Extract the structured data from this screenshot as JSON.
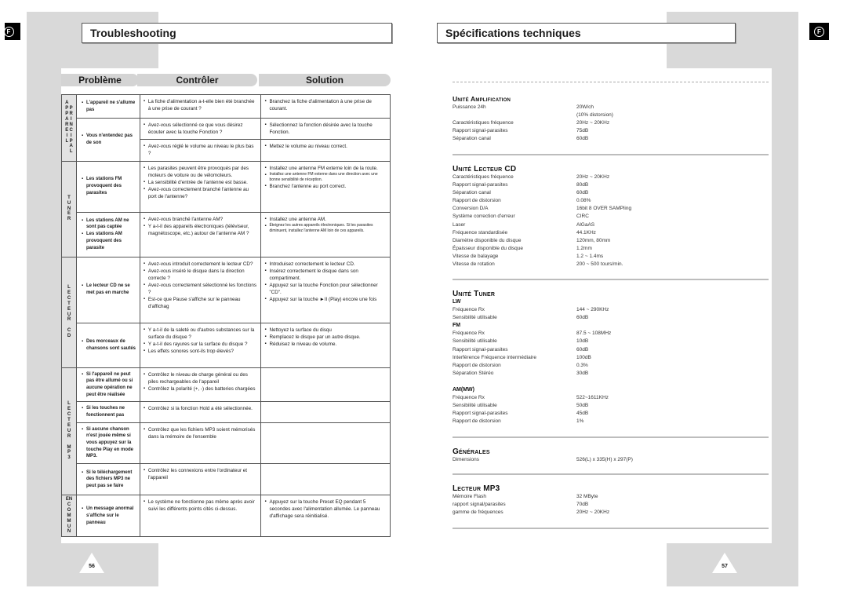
{
  "left_page": {
    "language_badge": "F",
    "title": "Troubleshooting",
    "headers": {
      "problem": "Problème",
      "check": "Contrôler",
      "solution": "Solution"
    },
    "groups": [
      {
        "category": "A\nP\nP\nA\nR\nE\nI\nL",
        "category2": "\nP\nR\nI\nN\nC\nI\nP\nA\nL",
        "rows": [
          {
            "problem": "L'appareil ne s'allume pas",
            "checks": [
              "La fiche d'alimentation a-t-elle bien été branchée à une prise de courant ?"
            ],
            "solutions": [
              "Branchez la fiche d'alimentation à une prise de courant."
            ]
          },
          {
            "problem": "Vous n'entendez pas de son",
            "checks": [
              "Avez-vous sélectionné ce que vous désirez écouter avec la touche Fonction ?"
            ],
            "solutions": [
              "Sélectionnez la fonction désirée avec la touche Fonction."
            ]
          },
          {
            "problem": "",
            "checks": [
              "Avez-vous réglé le volume au niveau le plus bas ?"
            ],
            "solutions": [
              "Mettez le volume au niveau correct."
            ]
          }
        ]
      },
      {
        "category": "T\nU\nN\nE\nR",
        "rows": [
          {
            "problem": "Les stations FM provoquent des parasites",
            "checks": [
              "Les parasites peuvent être provoqués par des moteurs de voiture ou de vélomoteurs.",
              "La sensibilité d'entrée de l'antenne est basse.",
              "Avez-vous correctement branché l'antenne au port de l'antenne?"
            ],
            "solutions": [
              "Installez une antenne FM externe loin de la route.",
              "Installez une antenne FM externe dans une direction avec une bonne sensibilité de réception.",
              "Branchez l'antenne au port correct."
            ]
          },
          {
            "problem": "Les stations AM ne sont pas captée",
            "problem2": "Les stations AM provoquent des parasite",
            "checks": [
              "Avez-vous branché l'antenne AM?",
              "Y a-t-il des appareils électroniques (téléviseur, magnétoscope, etc.) autour de l'antenne AM ?"
            ],
            "solutions": [
              "Installez une antenne AM.",
              "Éteignez les autres appareils électroniques. Si les parasites diminuent, installez l'antenne AM loin de ces appareils."
            ]
          }
        ]
      },
      {
        "category": "L\nE\nC\nT\nE\nU\nR\n\nC\nD",
        "rows": [
          {
            "problem": "Le lecteur CD ne se met pas en marche",
            "checks": [
              "Avez-vous introduit correctement le lecteur CD?",
              "Avez-vous inséré le disque dans la direction correcte ?",
              "Avez-vous correctement sélectionné les fonctions ?",
              "Est-ce que Pause s'affiche sur le panneau d'affichag"
            ],
            "solutions": [
              "Introduisez correctement le lecteur CD.",
              "Insérez correctement le disque dans son compartiment.",
              "Appuyez sur la touche Fonction pour sélectionner \"CD\".",
              "Appuyez sur la touche ►II (Play) encore une fois"
            ]
          },
          {
            "problem": "Des morceaux de chansons sont sautés",
            "checks": [
              "Y a-t-il de la saleté ou d'autres substances sur la surface du disque ?",
              "Y a-t-il des rayures sur la surface du disque ?",
              "Les effets sonores sont-ils trop élevés?"
            ],
            "solutions": [
              "Nettoyez la surface du disqu",
              "Remplacez le disque par un autre disque.",
              "Réduisez le niveau de volume."
            ]
          }
        ]
      },
      {
        "category": "L\nE\nC\nT\nE\nU\nR\n\nM\nP\n3",
        "rows": [
          {
            "problem": "Si l'appareil ne peut pas être allumé ou si aucune opération ne peut être réalisée",
            "checks": [
              "Contrôlez le niveau de charge général ou des piles rechargeables de l'appareil",
              "Contrôlez la polarité (+, -) des batteries chargées"
            ],
            "solutions": []
          },
          {
            "problem": "Si les touches ne fonctionnent pas",
            "checks": [
              "Contrôlez si la fonction Hold a été sélectionnée."
            ],
            "solutions": []
          },
          {
            "problem": "Si aucune chanson n'est jouée même si vous appuyez sur la touche Play en mode MP3.",
            "checks": [
              "Contrôlez que les fichiers MP3 soient mémorisés dans la mémoire de l'ensemble"
            ],
            "solutions": []
          },
          {
            "problem": "Si le téléchargement des fichiers MP3 ne peut pas se faire",
            "checks": [
              "Contrôlez les connexions entre l'ordinateur et l'appareil"
            ],
            "solutions": []
          }
        ]
      },
      {
        "category": "EN\nC\nO\nM\nM\nU\nN",
        "rows": [
          {
            "problem": "Un message anormal s'affiche sur le panneau",
            "checks": [
              "Le système ne fonctionne pas même après avoir suivi les différents points cités ci-dessus."
            ],
            "solutions": [
              "Appuyez sur la touche Preset EQ pendant 5 secondes avec l'alimentation allumée. Le panneau d'affichage sera réinitialisé."
            ]
          }
        ]
      }
    ],
    "page_number": "56"
  },
  "right_page": {
    "language_badge": "F",
    "title": "Spécifications techniques",
    "sections": [
      {
        "title": "Unité Amplification",
        "rows": [
          {
            "k": "Puissance 24h",
            "v": "20W/ch"
          },
          {
            "k": "",
            "v": "(10% distorsion)"
          },
          {
            "k": "Caractéristiques fréquence",
            "v": "20Hz ~ 20KHz"
          },
          {
            "k": "Rapport signal-parasites",
            "v": "75dB"
          },
          {
            "k": "Séparation canal",
            "v": "60dB"
          }
        ]
      },
      {
        "title": "Unité Lecteur CD",
        "rows": [
          {
            "k": "Caractéristiques fréquence",
            "v": "20Hz ~ 20KHz"
          },
          {
            "k": "Rapport signal-parasites",
            "v": "80dB"
          },
          {
            "k": "Séparation canal",
            "v": "60dB"
          },
          {
            "k": "Rapport de distorsion",
            "v": "0.08%"
          },
          {
            "k": "Conversion D/A",
            "v": "16bit 8 OVER SAMPling"
          },
          {
            "k": "Système correction d'erreur",
            "v": "CIRC"
          },
          {
            "k": "Laser",
            "v": "AlGaAS"
          },
          {
            "k": "Fréquence standardisée",
            "v": "44.1KHz"
          },
          {
            "k": "Diamètre disponible du disque",
            "v": "120mm, 80mm"
          },
          {
            "k": "Épaisseur disponible du disque",
            "v": "1.2mm"
          },
          {
            "k": "Vitesse de balayage",
            "v": "1.2 ~ 1.4ms"
          },
          {
            "k": "Vitesse de rotation",
            "v": "200 ~ 500 tours/min."
          }
        ]
      },
      {
        "title": "Unité Tuner",
        "subsections": [
          {
            "name": "LW",
            "rows": [
              {
                "k": "Fréquence Rx",
                "v": "144 ~ 290KHz"
              },
              {
                "k": "Sensibilité utilisable",
                "v": "60dB"
              }
            ]
          },
          {
            "name": "FM",
            "rows": [
              {
                "k": "Fréquence Rx",
                "v": "87.5 ~ 108MHz"
              },
              {
                "k": "Sensibilité utilisable",
                "v": "10dB"
              },
              {
                "k": "Rapport signal-parasites",
                "v": "60dB"
              },
              {
                "k": "Interférence Fréquence intermédiaire",
                "v": "100dB"
              },
              {
                "k": "Rapport de distorsion",
                "v": "0.3%"
              },
              {
                "k": "Séparation Stéréo",
                "v": "30dB"
              }
            ]
          },
          {
            "name": "AM(MW)",
            "rows": [
              {
                "k": "Fréquence Rx",
                "v": "522~1611KHz"
              },
              {
                "k": "Sensibilité utilisable",
                "v": "50dB"
              },
              {
                "k": "Rapport signal-parasites",
                "v": "45dB"
              },
              {
                "k": "Rapport de distorsion",
                "v": "1%"
              }
            ]
          }
        ]
      },
      {
        "title": "Générales",
        "rows": [
          {
            "k": "Dimensions",
            "v": "526(L) x 335(H) x 297(P)"
          }
        ]
      },
      {
        "title": "Lecteur MP3",
        "rows": [
          {
            "k": "Mémoire Flash",
            "v": "32 MByte"
          },
          {
            "k": "rapport signal/parasites",
            "v": "70dB"
          },
          {
            "k": "gamme de fréquences",
            "v": "20Hz ~ 20KHz"
          }
        ]
      }
    ],
    "page_number": "57"
  }
}
